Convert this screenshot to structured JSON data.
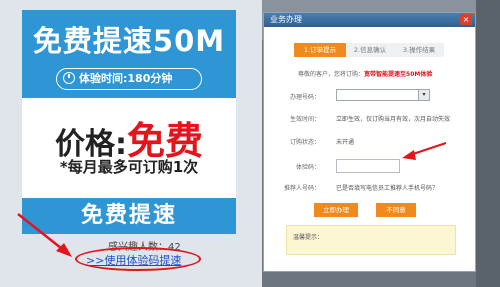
{
  "promo": {
    "title": "免费提速50M",
    "trial_time": "体验时间:180分钟",
    "price_label": "价格:",
    "price_value": "免费",
    "monthly_limit": "*每月最多可订购1次",
    "speed_button": "免费提速",
    "interested_count": "感兴趣人数：42",
    "code_link": ">>使用体验码提速"
  },
  "dialog": {
    "title": "业务办理",
    "close": "×",
    "steps": [
      "1.订单提示",
      "2.信息确认",
      "3.操作结果"
    ],
    "greeting_prefix": "尊敬的客户，您将订购：",
    "greeting_offer": "宽带智能提速至50M体验",
    "rows": {
      "phone_label": "办理号码：",
      "effective_label": "生效时间：",
      "effective_value": "立即生效，仅订购当月有效，次月自动失效",
      "status_label": "订购状态：",
      "status_value": "未开通",
      "code_label": "体验码：",
      "recommender_label": "推荐人号码：",
      "recommender_value": "已是否填写电信员工推荐人手机号码？"
    },
    "phone_dropdown_icon": "▾",
    "submit_button": "立即办理",
    "cancel_button": "不同意",
    "tips_label": "温馨提示："
  },
  "colors": {
    "brand_blue": "#2f96d6",
    "accent_orange": "#f08a1c",
    "price_red": "#e3141c",
    "annotation_red": "#e3141c"
  }
}
